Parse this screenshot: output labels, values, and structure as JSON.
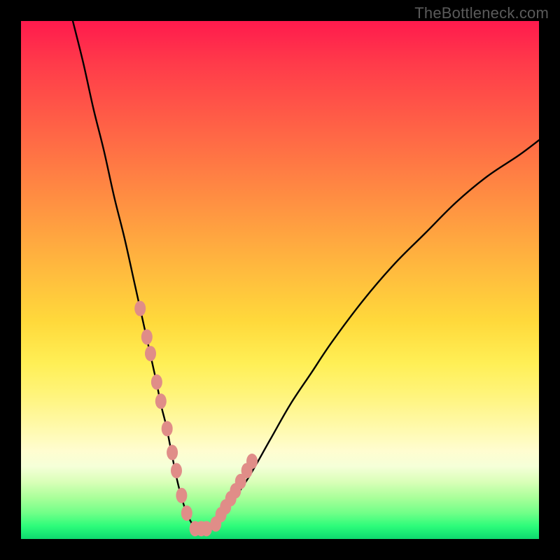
{
  "watermark": {
    "text": "TheBottleneck.com"
  },
  "chart_data": {
    "type": "line",
    "title": "",
    "xlabel": "",
    "ylabel": "",
    "xlim": [
      0,
      100
    ],
    "ylim": [
      0,
      100
    ],
    "grid": false,
    "series": [
      {
        "name": "curve",
        "x": [
          10,
          12,
          14,
          16,
          18,
          20,
          22,
          24,
          26,
          27,
          28,
          29,
          30,
          31,
          32,
          33,
          34,
          36,
          38,
          40,
          44,
          48,
          52,
          56,
          60,
          66,
          72,
          78,
          84,
          90,
          96,
          100
        ],
        "y": [
          100,
          92,
          83,
          75,
          66,
          58,
          49,
          40,
          31,
          26,
          22,
          17,
          12,
          8,
          5,
          3,
          2,
          2,
          3,
          6,
          12,
          19,
          26,
          32,
          38,
          46,
          53,
          59,
          65,
          70,
          74,
          77
        ]
      }
    ],
    "markers": {
      "name": "dots",
      "color": "#e08d88",
      "x": [
        23,
        24.3,
        25,
        26.2,
        27,
        28.2,
        29.2,
        30,
        31,
        32,
        33.6,
        34.8,
        35.8,
        37.6,
        38.6,
        39.5,
        40.5,
        41.4,
        42.4,
        43.6,
        44.6
      ],
      "y": [
        44.5,
        39,
        35.8,
        30.3,
        26.6,
        21.3,
        16.7,
        13.2,
        8.4,
        5,
        2,
        2,
        2,
        2.9,
        4.7,
        6.2,
        7.8,
        9.3,
        11.1,
        13.2,
        15
      ]
    }
  }
}
